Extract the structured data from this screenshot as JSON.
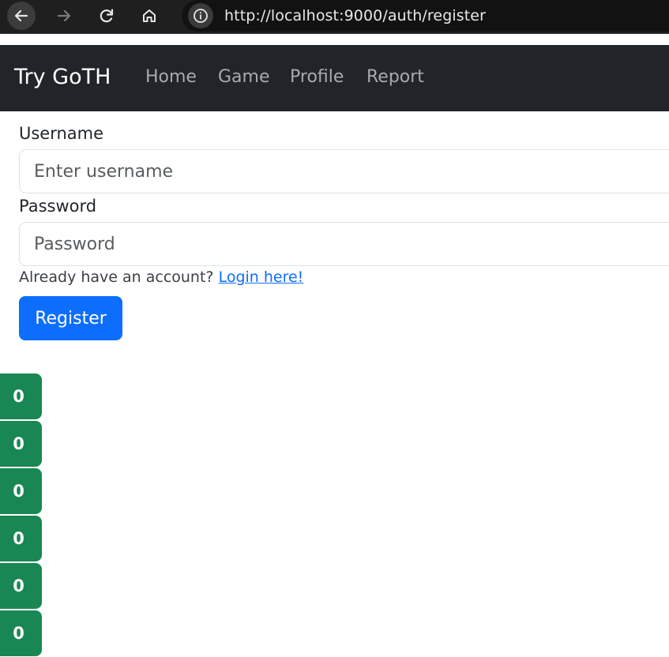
{
  "browser": {
    "url": "http://localhost:9000/auth/register"
  },
  "navbar": {
    "brand": "Try GoTH",
    "links": [
      "Home",
      "Game",
      "Profile",
      "Report"
    ]
  },
  "form": {
    "username_label": "Username",
    "username_placeholder": "Enter username",
    "password_label": "Password",
    "password_placeholder": "Password",
    "login_prompt": "Already have an account?",
    "login_link": "Login here!",
    "register_button": "Register"
  },
  "counters": [
    "0",
    "0",
    "0",
    "0",
    "0",
    "0"
  ],
  "colors": {
    "navbar_bg": "#212529",
    "primary": "#0d6efd",
    "success": "#198754",
    "browser_bg": "#1f1f1f"
  }
}
